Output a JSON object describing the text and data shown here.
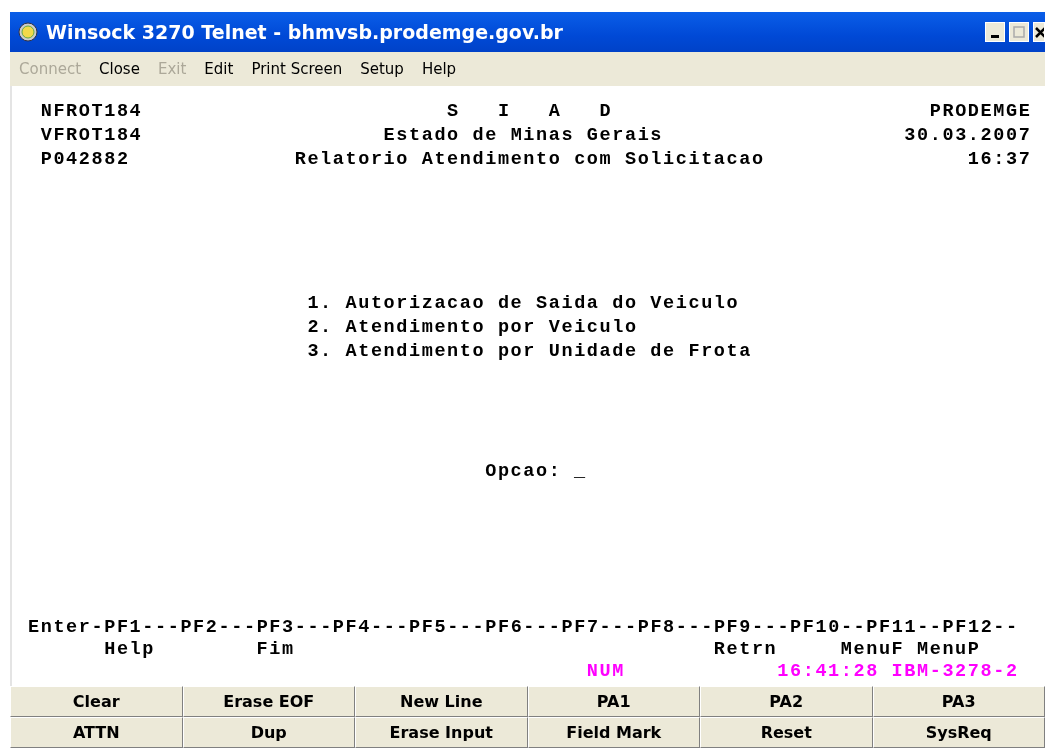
{
  "window": {
    "title": "Winsock 3270 Telnet - bhmvsb.prodemge.gov.br"
  },
  "menu": [
    {
      "label": "Connect",
      "disabled": true
    },
    {
      "label": "Close",
      "disabled": false
    },
    {
      "label": "Exit",
      "disabled": true
    },
    {
      "label": "Edit",
      "disabled": false
    },
    {
      "label": "Print Screen",
      "disabled": false
    },
    {
      "label": "Setup",
      "disabled": false
    },
    {
      "label": "Help",
      "disabled": false
    }
  ],
  "screen": {
    "header": [
      [
        "NFROT184",
        "S   I   A   D",
        "PRODEMGE"
      ],
      [
        "VFROT184",
        "Estado de Minas Gerais",
        "30.03.2007"
      ],
      [
        "P042882",
        "Relatorio Atendimento com Solicitacao",
        "16:37"
      ]
    ],
    "options": [
      "1. Autorizacao de Saida do Veiculo",
      "2. Atendimento por Veiculo",
      "3. Atendimento por Unidade de Frota"
    ],
    "prompt": "Opcao: _",
    "pf_line": "Enter-PF1---PF2---PF3---PF4---PF5---PF6---PF7---PF8---PF9---PF10--PF11--PF12--",
    "pf_labels": [
      "Help",
      "Fim",
      "Retrn",
      "MenuF",
      "MenuP"
    ]
  },
  "status": {
    "indicator": "NUM",
    "time_model": "16:41:28 IBM-3278-2"
  },
  "keys": [
    [
      "Clear",
      "Erase EOF",
      "New Line",
      "PA1",
      "PA2",
      "PA3"
    ],
    [
      "ATTN",
      "Dup",
      "Erase Input",
      "Field Mark",
      "Reset",
      "SysReq"
    ]
  ]
}
